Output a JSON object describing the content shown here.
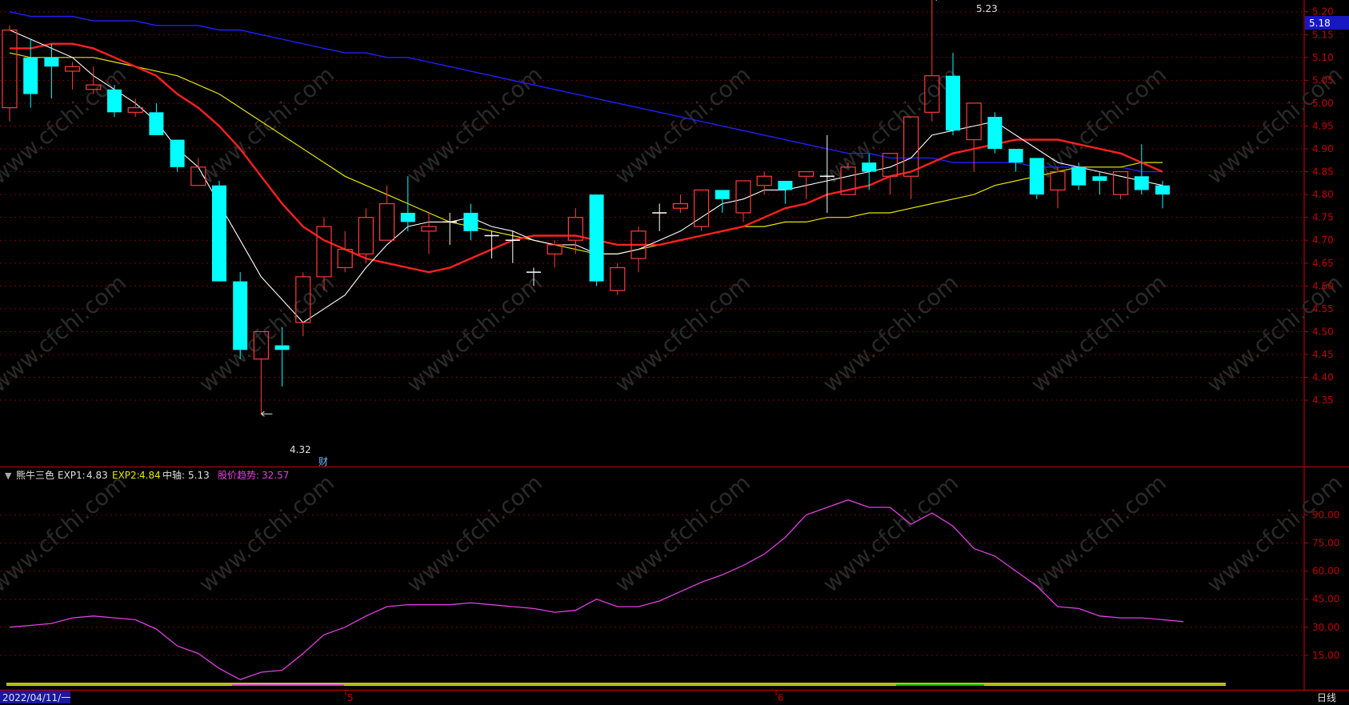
{
  "indicator": {
    "name": "熊牛三色",
    "exp1_label": "EXP1:",
    "exp1_value": "4.83",
    "exp2_label": "EXP2:",
    "exp2_value": "4.84",
    "axis_label": "中轴:",
    "axis_value": "5.13",
    "trend_label": "股价趋势:",
    "trend_value": "32.57"
  },
  "price_badge": "5.18",
  "high_label": "5.23",
  "low_label": "4.32",
  "fin_marker": "财",
  "date_start": "2022/04/11/一",
  "month_labels": [
    "5",
    "6"
  ],
  "period_label": "日线",
  "watermark": "www.cfchi.com",
  "colors": {
    "up": "#ff3b3b",
    "down": "#00ffff",
    "ma5": "#ffffff",
    "ma10": "#ff2020",
    "ma20": "#e6e600",
    "ma60": "#2020ff",
    "trend": "#e040e0",
    "grid": "#7a0000",
    "axis_text": "#c00000"
  },
  "chart_data": [
    {
      "type": "candlestick",
      "price_axis_ticks": [
        "5.20",
        "5.15",
        "5.10",
        "5.05",
        "5.00",
        "4.95",
        "4.90",
        "4.85",
        "4.80",
        "4.75",
        "4.70",
        "4.65",
        "4.60",
        "4.55",
        "4.50",
        "4.45",
        "4.40",
        "4.35"
      ],
      "ylim": [
        4.3,
        5.21
      ],
      "candles": [
        {
          "o": 4.99,
          "h": 5.17,
          "l": 4.96,
          "c": 5.16
        },
        {
          "o": 5.1,
          "h": 5.14,
          "l": 4.99,
          "c": 5.02
        },
        {
          "o": 5.1,
          "h": 5.13,
          "l": 5.01,
          "c": 5.08
        },
        {
          "o": 5.07,
          "h": 5.09,
          "l": 5.03,
          "c": 5.08
        },
        {
          "o": 5.03,
          "h": 5.08,
          "l": 5.02,
          "c": 5.04
        },
        {
          "o": 5.03,
          "h": 5.04,
          "l": 4.97,
          "c": 4.98
        },
        {
          "o": 4.98,
          "h": 5.01,
          "l": 4.97,
          "c": 4.99
        },
        {
          "o": 4.98,
          "h": 5.0,
          "l": 4.93,
          "c": 4.93
        },
        {
          "o": 4.92,
          "h": 4.92,
          "l": 4.85,
          "c": 4.86
        },
        {
          "o": 4.82,
          "h": 4.88,
          "l": 4.82,
          "c": 4.86
        },
        {
          "o": 4.82,
          "h": 4.83,
          "l": 4.61,
          "c": 4.61
        },
        {
          "o": 4.61,
          "h": 4.63,
          "l": 4.44,
          "c": 4.46
        },
        {
          "o": 4.44,
          "h": 4.5,
          "l": 4.32,
          "c": 4.5
        },
        {
          "o": 4.47,
          "h": 4.51,
          "l": 4.38,
          "c": 4.46
        },
        {
          "o": 4.52,
          "h": 4.63,
          "l": 4.49,
          "c": 4.62
        },
        {
          "o": 4.62,
          "h": 4.75,
          "l": 4.59,
          "c": 4.73
        },
        {
          "o": 4.64,
          "h": 4.72,
          "l": 4.63,
          "c": 4.68
        },
        {
          "o": 4.67,
          "h": 4.77,
          "l": 4.65,
          "c": 4.75
        },
        {
          "o": 4.7,
          "h": 4.82,
          "l": 4.7,
          "c": 4.78
        },
        {
          "o": 4.76,
          "h": 4.84,
          "l": 4.72,
          "c": 4.74
        },
        {
          "o": 4.72,
          "h": 4.76,
          "l": 4.67,
          "c": 4.73
        },
        {
          "o": 4.74,
          "h": 4.76,
          "l": 4.69,
          "c": 4.74
        },
        {
          "o": 4.76,
          "h": 4.78,
          "l": 4.7,
          "c": 4.72
        },
        {
          "o": 4.71,
          "h": 4.72,
          "l": 4.66,
          "c": 4.71
        },
        {
          "o": 4.7,
          "h": 4.72,
          "l": 4.65,
          "c": 4.7
        },
        {
          "o": 4.63,
          "h": 4.64,
          "l": 4.6,
          "c": 4.63
        },
        {
          "o": 4.67,
          "h": 4.7,
          "l": 4.64,
          "c": 4.69
        },
        {
          "o": 4.7,
          "h": 4.77,
          "l": 4.67,
          "c": 4.75
        },
        {
          "o": 4.8,
          "h": 4.8,
          "l": 4.6,
          "c": 4.61
        },
        {
          "o": 4.59,
          "h": 4.65,
          "l": 4.58,
          "c": 4.64
        },
        {
          "o": 4.66,
          "h": 4.73,
          "l": 4.63,
          "c": 4.72
        },
        {
          "o": 4.76,
          "h": 4.78,
          "l": 4.72,
          "c": 4.76
        },
        {
          "o": 4.77,
          "h": 4.8,
          "l": 4.76,
          "c": 4.78
        },
        {
          "o": 4.73,
          "h": 4.81,
          "l": 4.72,
          "c": 4.81
        },
        {
          "o": 4.81,
          "h": 4.81,
          "l": 4.76,
          "c": 4.79
        },
        {
          "o": 4.76,
          "h": 4.83,
          "l": 4.74,
          "c": 4.83
        },
        {
          "o": 4.82,
          "h": 4.85,
          "l": 4.8,
          "c": 4.84
        },
        {
          "o": 4.83,
          "h": 4.83,
          "l": 4.78,
          "c": 4.81
        },
        {
          "o": 4.84,
          "h": 4.85,
          "l": 4.79,
          "c": 4.85
        },
        {
          "o": 4.84,
          "h": 4.93,
          "l": 4.76,
          "c": 4.84
        },
        {
          "o": 4.8,
          "h": 4.87,
          "l": 4.8,
          "c": 4.86
        },
        {
          "o": 4.87,
          "h": 4.89,
          "l": 4.81,
          "c": 4.85
        },
        {
          "o": 4.84,
          "h": 4.89,
          "l": 4.8,
          "c": 4.89
        },
        {
          "o": 4.84,
          "h": 4.97,
          "l": 4.79,
          "c": 4.97
        },
        {
          "o": 4.98,
          "h": 5.23,
          "l": 4.96,
          "c": 5.06
        },
        {
          "o": 5.06,
          "h": 5.11,
          "l": 4.93,
          "c": 4.94
        },
        {
          "o": 4.92,
          "h": 5.0,
          "l": 4.85,
          "c": 5.0
        },
        {
          "o": 4.97,
          "h": 4.98,
          "l": 4.89,
          "c": 4.9
        },
        {
          "o": 4.9,
          "h": 4.9,
          "l": 4.85,
          "c": 4.87
        },
        {
          "o": 4.88,
          "h": 4.88,
          "l": 4.79,
          "c": 4.8
        },
        {
          "o": 4.81,
          "h": 4.86,
          "l": 4.77,
          "c": 4.85
        },
        {
          "o": 4.86,
          "h": 4.87,
          "l": 4.81,
          "c": 4.82
        },
        {
          "o": 4.84,
          "h": 4.85,
          "l": 4.8,
          "c": 4.83
        },
        {
          "o": 4.8,
          "h": 4.85,
          "l": 4.79,
          "c": 4.85
        },
        {
          "o": 4.84,
          "h": 4.91,
          "l": 4.8,
          "c": 4.81
        },
        {
          "o": 4.82,
          "h": 4.83,
          "l": 4.77,
          "c": 4.8
        }
      ],
      "ma5": [
        5.16,
        5.14,
        5.12,
        5.1,
        5.06,
        5.03,
        5.0,
        4.96,
        4.9,
        4.86,
        4.78,
        4.7,
        4.62,
        4.57,
        4.52,
        4.55,
        4.58,
        4.64,
        4.69,
        4.73,
        4.74,
        4.74,
        4.75,
        4.73,
        4.72,
        4.7,
        4.69,
        4.69,
        4.67,
        4.67,
        4.68,
        4.7,
        4.72,
        4.75,
        4.78,
        4.79,
        4.81,
        4.81,
        4.82,
        4.83,
        4.84,
        4.85,
        4.86,
        4.88,
        4.93,
        4.94,
        4.95,
        4.96,
        4.93,
        4.9,
        4.87,
        4.86,
        4.85,
        4.84,
        4.83,
        4.82
      ],
      "ma10": [
        5.12,
        5.12,
        5.13,
        5.13,
        5.12,
        5.1,
        5.08,
        5.06,
        5.02,
        4.99,
        4.95,
        4.9,
        4.84,
        4.78,
        4.73,
        4.7,
        4.68,
        4.66,
        4.65,
        4.64,
        4.63,
        4.64,
        4.66,
        4.68,
        4.7,
        4.71,
        4.71,
        4.71,
        4.7,
        4.69,
        4.69,
        4.69,
        4.7,
        4.71,
        4.72,
        4.73,
        4.75,
        4.77,
        4.78,
        4.8,
        4.81,
        4.82,
        4.84,
        4.85,
        4.87,
        4.89,
        4.9,
        4.91,
        4.92,
        4.92,
        4.92,
        4.91,
        4.9,
        4.89,
        4.87,
        4.85
      ],
      "ma20": [
        5.11,
        5.1,
        5.1,
        5.1,
        5.1,
        5.09,
        5.08,
        5.07,
        5.06,
        5.04,
        5.02,
        4.99,
        4.96,
        4.93,
        4.9,
        4.87,
        4.84,
        4.82,
        4.8,
        4.78,
        4.76,
        4.74,
        4.73,
        4.72,
        4.71,
        4.7,
        4.69,
        4.68,
        4.67,
        4.67,
        4.68,
        4.69,
        4.7,
        4.71,
        4.72,
        4.73,
        4.73,
        4.74,
        4.74,
        4.75,
        4.75,
        4.76,
        4.76,
        4.77,
        4.78,
        4.79,
        4.8,
        4.82,
        4.83,
        4.84,
        4.85,
        4.86,
        4.86,
        4.86,
        4.87,
        4.87
      ],
      "ma60": [
        5.2,
        5.19,
        5.19,
        5.19,
        5.18,
        5.18,
        5.18,
        5.17,
        5.17,
        5.17,
        5.16,
        5.16,
        5.15,
        5.14,
        5.13,
        5.12,
        5.11,
        5.11,
        5.1,
        5.1,
        5.09,
        5.08,
        5.07,
        5.06,
        5.05,
        5.04,
        5.03,
        5.02,
        5.01,
        5.0,
        4.99,
        4.98,
        4.97,
        4.96,
        4.95,
        4.94,
        4.93,
        4.92,
        4.91,
        4.9,
        4.89,
        4.89,
        4.88,
        4.88,
        4.88,
        4.87,
        4.87,
        4.87,
        4.87,
        4.86,
        4.86,
        4.86,
        4.86,
        4.86,
        4.85,
        4.85
      ]
    },
    {
      "type": "line",
      "series_name": "股价趋势",
      "ylim": [
        0,
        105
      ],
      "axis_ticks": [
        "90.00",
        "75.00",
        "60.00",
        "45.00",
        "30.00",
        "15.00"
      ],
      "values": [
        30,
        31,
        32,
        35,
        36,
        35,
        34,
        29,
        20,
        16,
        8,
        2,
        6,
        7,
        16,
        26,
        30,
        36,
        41,
        42,
        42,
        42,
        43,
        42,
        41,
        40,
        38,
        39,
        45,
        41,
        41,
        44,
        49,
        54,
        58,
        63,
        69,
        78,
        90,
        94,
        98,
        94,
        94,
        85,
        91,
        84,
        72,
        68,
        60,
        52,
        41,
        40,
        36,
        35,
        35,
        34,
        33
      ]
    }
  ]
}
